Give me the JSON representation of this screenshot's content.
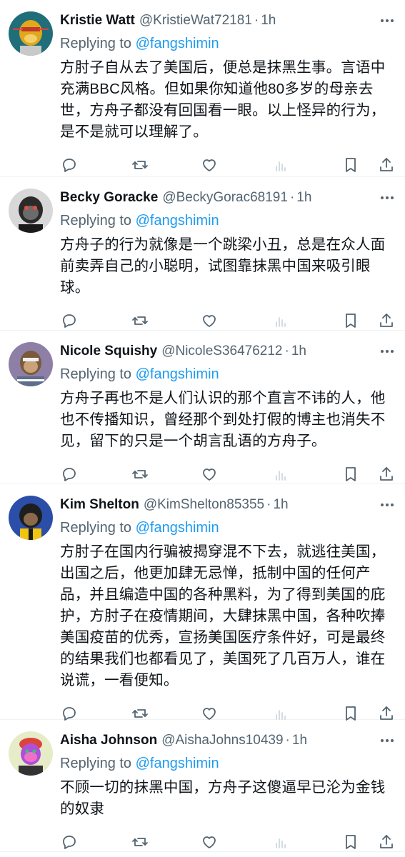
{
  "reply_prefix": "Replying to",
  "colors": {
    "text": "#0f1419",
    "secondary": "#536471",
    "accent": "#1d9bf0",
    "divider": "#eff3f4"
  },
  "tweets": [
    {
      "name": "Kristie Watt",
      "handle": "@KristieWat72181",
      "sep": "·",
      "time": "1h",
      "mention": "@fangshimin",
      "text": "方肘子自从去了美国后，便总是抹黑生事。言语中\n充满BBC风格。但如果你知道他80多岁的母亲去\n世，方舟子都没有回国看一眼。以上怪异的行为，\n是不是就可以理解了。",
      "avatar_icon": "yellow-ape-avatar"
    },
    {
      "name": "Becky Goracke",
      "handle": "@BeckyGorac68191",
      "sep": "·",
      "time": "1h",
      "mention": "@fangshimin",
      "text": "方舟子的行为就像是一个跳梁小丑，总是在众人面\n前卖弄自己的小聪明，试图靠抹黑中国来吸引眼\n球。",
      "avatar_icon": "dark-ape-avatar"
    },
    {
      "name": "Nicole Squishy",
      "handle": "@NicoleS36476212",
      "sep": "·",
      "time": "1h",
      "mention": "@fangshimin",
      "text": "方舟子再也不是人们认识的那个直言不讳的人，他\n也不传播知识，曾经那个到处打假的博主也消失不\n见，留下的只是一个胡言乱语的方舟子。",
      "avatar_icon": "purple-ape-avatar"
    },
    {
      "name": "Kim Shelton",
      "handle": "@KimShelton85355",
      "sep": "·",
      "time": "1h",
      "mention": "@fangshimin",
      "text": "方肘子在国内行骗被揭穿混不下去，就逃往美国，\n出国之后，他更加肆无忌惮，抵制中国的任何产\n品，并且编造中国的各种黑料，为了得到美国的庇\n护，方肘子在疫情期间，大肆抹黑中国，各种吹捧\n美国疫苗的优秀，宣扬美国医疗条件好，可是最终\n的结果我们也都看见了，美国死了几百万人，谁在\n说谎，一看便知。",
      "avatar_icon": "blue-ape-avatar"
    },
    {
      "name": "Aisha Johnson",
      "handle": "@AishaJohns10439",
      "sep": "·",
      "time": "1h",
      "mention": "@fangshimin",
      "text": "不顾一切的抹黑中国，方舟子这傻逼早已沦为金钱\n的奴隶",
      "avatar_icon": "neon-ape-avatar"
    }
  ]
}
